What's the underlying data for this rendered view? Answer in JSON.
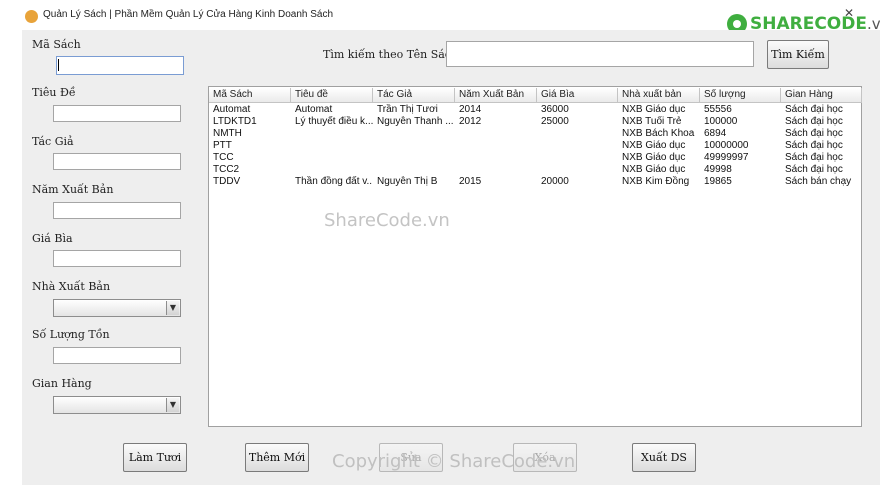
{
  "window": {
    "title": "Quản Lý Sách | Phần Mềm Quản Lý Cửa Hàng Kinh Doanh Sách",
    "icon": "app-book-icon"
  },
  "brand": {
    "name": "SHARECODE",
    "suffix": ".vn"
  },
  "form": {
    "ma_sach_label": "Mã Sách",
    "tieu_de_label": "Tiêu Đề",
    "tac_gia_label": "Tác Giả",
    "nam_xuat_ban_label": "Năm Xuất Bản",
    "gia_bia_label": "Giá Bìa",
    "nha_xuat_ban_label": "Nhà Xuất Bản",
    "so_luong_ton_label": "Số Lượng Tồn",
    "gian_hang_label": "Gian Hàng",
    "ma_sach_value": "",
    "tieu_de_value": "",
    "tac_gia_value": "",
    "nam_xuat_ban_value": "",
    "gia_bia_value": "",
    "so_luong_ton_value": "",
    "nha_xuat_ban_selected": "",
    "gian_hang_selected": ""
  },
  "search": {
    "label": "Tìm kiếm theo Tên Sách",
    "value": "",
    "button_label": "Tìm Kiếm"
  },
  "table": {
    "columns": [
      "Mã Sách",
      "Tiêu đề",
      "Tác Giả",
      "Năm Xuất Bản",
      "Giá Bìa",
      "Nhà xuất bản",
      "Số lượng",
      "Gian Hàng"
    ],
    "rows": [
      [
        "Automat",
        "Automat",
        "Trần Thị Tươi",
        "2014",
        "36000",
        "NXB Giáo dục",
        "55556",
        "Sách đại học"
      ],
      [
        "LTDKTD1",
        "Lý thuyết điều k...",
        "Nguyễn Thanh ...",
        "2012",
        "25000",
        "NXB Tuổi Trẻ",
        "100000",
        "Sách đại học"
      ],
      [
        "NMTH",
        "",
        "",
        "",
        "",
        "NXB Bách Khoa",
        "6894",
        "Sách đại học"
      ],
      [
        "PTT",
        "",
        "",
        "",
        "",
        "NXB Giáo dục",
        "10000000",
        "Sách đại học"
      ],
      [
        "TCC",
        "",
        "",
        "",
        "",
        "NXB Giáo dục",
        "49999997",
        "Sách đại học"
      ],
      [
        "TCC2",
        "",
        "",
        "",
        "",
        "NXB Giáo dục",
        "49998",
        "Sách đại học"
      ],
      [
        "TDDV",
        "Thần đồng đất v...",
        "Nguyễn Thị B",
        "2015",
        "20000",
        "NXB Kim Đồng",
        "19865",
        "Sách bán chạy"
      ]
    ]
  },
  "buttons": {
    "lam_tuoi": "Làm Tươi",
    "them_moi": "Thêm Mới",
    "sua": "Sửa",
    "xoa": "Xóa",
    "xuat_ds": "Xuất DS"
  },
  "watermarks": {
    "center": "ShareCode.vn",
    "bottom": "Copyright © ShareCode.vn"
  }
}
